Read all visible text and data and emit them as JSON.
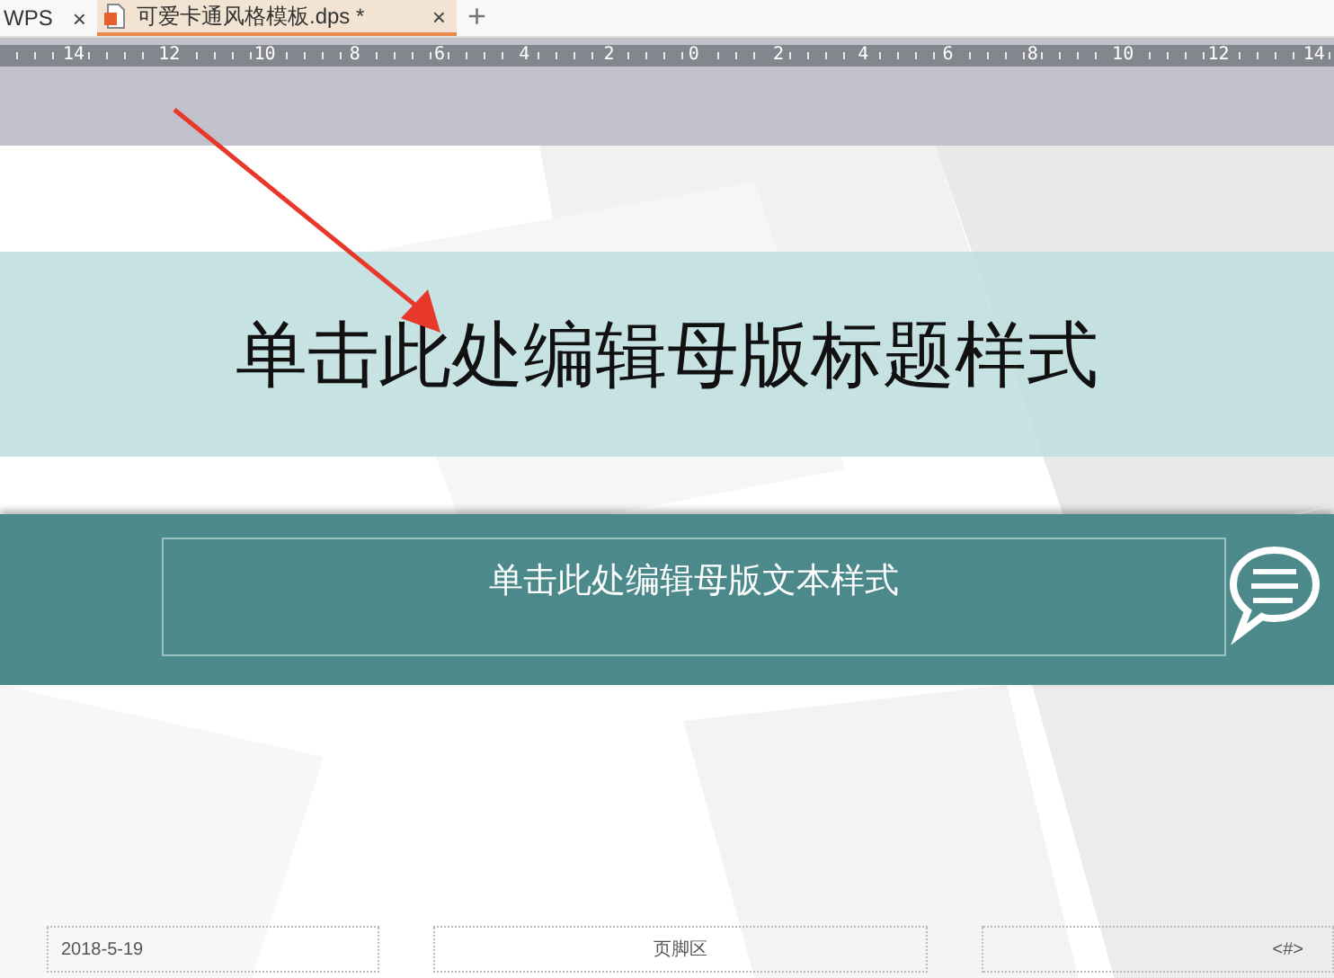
{
  "tabs": [
    {
      "label": "WPS",
      "close": "×",
      "selected": false
    },
    {
      "label": "可爱卡通风格模板.dps *",
      "close": "×",
      "selected": true
    }
  ],
  "new_tab": "+",
  "ruler": {
    "labels": [
      "14",
      "12",
      "10",
      "8",
      "6",
      "4",
      "2",
      "0",
      "2",
      "4",
      "6",
      "8",
      "10",
      "12",
      "14"
    ]
  },
  "slide": {
    "title": "单击此处编辑母版标题样式",
    "body": "单击此处编辑母版文本样式",
    "footer": {
      "date": "2018-5-19",
      "text": "页脚区",
      "page_number": "<#>"
    }
  }
}
